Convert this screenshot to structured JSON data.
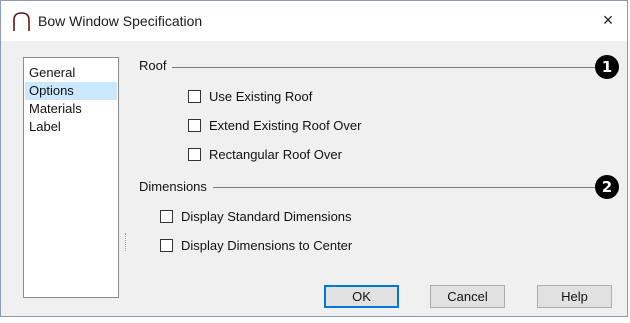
{
  "window": {
    "title": "Bow Window Specification",
    "close_label": "×"
  },
  "sidebar": {
    "items": [
      {
        "label": "General",
        "selected": false
      },
      {
        "label": "Options",
        "selected": true
      },
      {
        "label": "Materials",
        "selected": false
      },
      {
        "label": "Label",
        "selected": false
      }
    ]
  },
  "roof": {
    "label": "Roof",
    "callout": "1",
    "options": [
      {
        "label": "Use Existing Roof",
        "checked": false
      },
      {
        "label": "Extend Existing Roof Over",
        "checked": false
      },
      {
        "label": "Rectangular Roof Over",
        "checked": false
      }
    ]
  },
  "dimensions": {
    "label": "Dimensions",
    "callout": "2",
    "options": [
      {
        "label": "Display Standard Dimensions",
        "checked": false
      },
      {
        "label": "Display Dimensions to Center",
        "checked": false
      }
    ]
  },
  "buttons": {
    "ok": "OK",
    "cancel": "Cancel",
    "help": "Help"
  },
  "colors": {
    "selection": "#cce8ff",
    "default_button_border": "#0078d7"
  }
}
